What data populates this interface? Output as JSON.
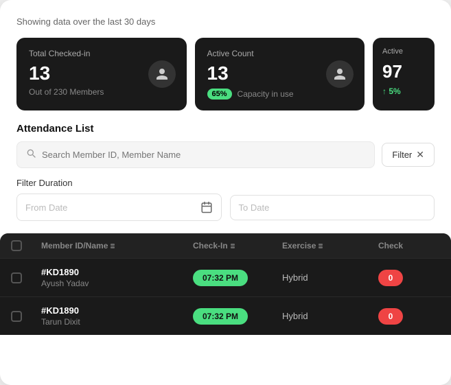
{
  "page": {
    "subtitle": "Showing data over the last 30 days",
    "cards": [
      {
        "id": "total-checked-in",
        "label": "Total Checked-in",
        "count": "13",
        "sub": "Out of 230 Members",
        "icon": "person-icon"
      },
      {
        "id": "active-count",
        "label": "Active Count",
        "count": "13",
        "capacity_pct": "65%",
        "capacity_label": "Capacity in use",
        "icon": "person-icon"
      },
      {
        "id": "active",
        "label": "Active",
        "count": "97",
        "trend": "↑ 5%"
      }
    ],
    "section_title": "Attendance List",
    "search": {
      "placeholder": "Search Member ID, Member Name"
    },
    "filter_button": "Filter",
    "filter_duration_label": "Filter Duration",
    "from_date_placeholder": "From Date",
    "to_date_placeholder": "To Date",
    "table": {
      "headers": [
        {
          "label": "Member ID/Name",
          "sortable": true
        },
        {
          "label": "Check-In",
          "sortable": true
        },
        {
          "label": "Exercise",
          "sortable": true
        },
        {
          "label": "Check",
          "sortable": false
        }
      ],
      "rows": [
        {
          "member_id": "#KD1890",
          "member_name": "Ayush Yadav",
          "checkin": "07:32 PM",
          "exercise": "Hybrid",
          "checkout": "0"
        },
        {
          "member_id": "#KD1890",
          "member_name": "Tarun Dixit",
          "checkin": "07:32 PM",
          "exercise": "Hybrid",
          "checkout": "0"
        }
      ]
    }
  }
}
